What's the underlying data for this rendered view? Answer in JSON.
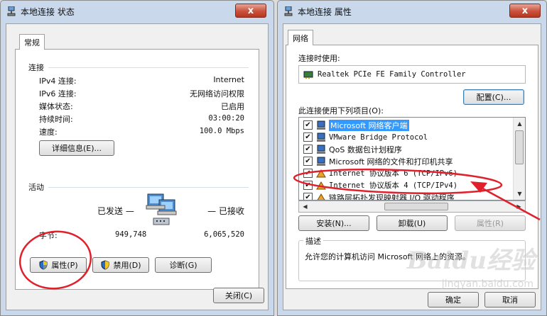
{
  "left": {
    "title": "本地连接 状态",
    "close": "x",
    "tab": "常规",
    "connection_header": "连接",
    "rows": [
      {
        "label": "IPv4 连接:",
        "value": "Internet"
      },
      {
        "label": "IPv6 连接:",
        "value": "无网络访问权限"
      },
      {
        "label": "媒体状态:",
        "value": "已启用"
      },
      {
        "label": "持续时间:",
        "value": "03:00:20"
      },
      {
        "label": "速度:",
        "value": "100.0 Mbps"
      }
    ],
    "details_button": "详细信息(E)...",
    "activity_header": "活动",
    "sent_label": "已发送 —",
    "received_label": "— 已接收",
    "bytes_label": "字节:",
    "bytes_sent": "949,748",
    "bytes_received": "6,065,520",
    "properties_button": "属性(P)",
    "disable_button": "禁用(D)",
    "diagnose_button": "诊断(G)",
    "close_button": "关闭(C)",
    "annotation_color": "#e0202a"
  },
  "right": {
    "title": "本地连接 属性",
    "close": "x",
    "tab": "网络",
    "connect_using_label": "连接时使用:",
    "adapter": "Realtek PCIe FE Family Controller",
    "configure_button": "配置(C)...",
    "items_label": "此连接使用下列项目(O):",
    "items": [
      {
        "text": "Microsoft 网络客户端",
        "checked": "✔",
        "icon": "network-client-icon"
      },
      {
        "text": "VMware Bridge Protocol",
        "checked": "✔",
        "icon": "network-protocol-icon"
      },
      {
        "text": "QoS 数据包计划程序",
        "checked": "✔",
        "icon": "network-protocol-icon"
      },
      {
        "text": "Microsoft 网络的文件和打印机共享",
        "checked": "✔",
        "icon": "network-protocol-icon"
      },
      {
        "text": "Internet 协议版本 6 (TCP/IPv6)",
        "checked": "✔",
        "icon": "protocol-icon"
      },
      {
        "text": "Internet 协议版本 4 (TCP/IPv4)",
        "checked": "✔",
        "icon": "protocol-icon"
      },
      {
        "text": "链路层拓扑发现映射器 I/O 驱动程序",
        "checked": "✔",
        "icon": "protocol-icon"
      }
    ],
    "install_button": "安装(N)...",
    "uninstall_button": "卸载(U)",
    "properties_button": "属性(R)",
    "description_header": "描述",
    "description": "允许您的计算机访问 Microsoft 网络上的资源。",
    "ok_button": "确定",
    "cancel_button": "取消",
    "watermark": "Baidu经验",
    "watermark_sub": "jingyan.baidu.com"
  }
}
